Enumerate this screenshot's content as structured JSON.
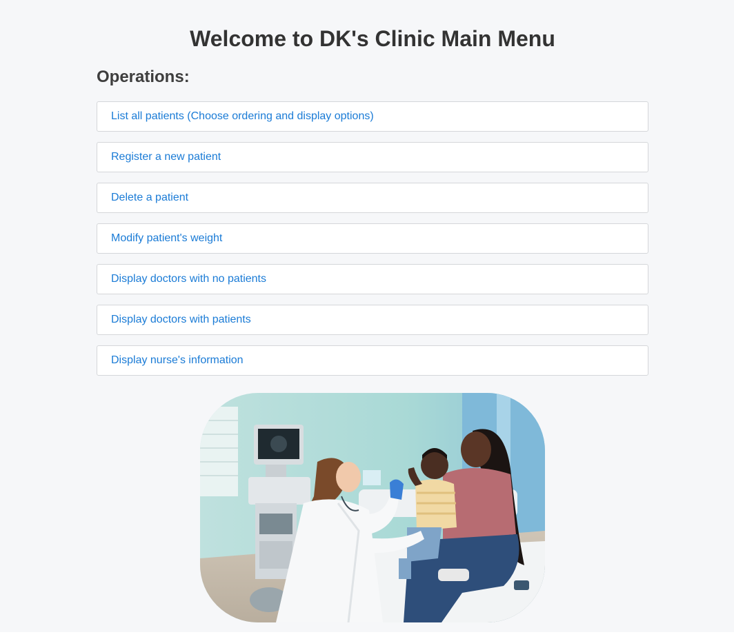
{
  "page": {
    "title": "Welcome to DK's Clinic Main Menu",
    "section_heading": "Operations:"
  },
  "menu": {
    "items": [
      {
        "label": "List all patients (Choose ordering and display options)"
      },
      {
        "label": "Register a new patient"
      },
      {
        "label": "Delete a patient"
      },
      {
        "label": "Modify patient's weight"
      },
      {
        "label": "Display doctors with no patients"
      },
      {
        "label": "Display doctors with patients"
      },
      {
        "label": "Display nurse's information"
      }
    ]
  },
  "colors": {
    "background": "#f6f7f9",
    "link": "#1a7bd6",
    "heading": "#333333",
    "button_border": "#d4d6d9"
  },
  "image": {
    "subject": "clinic-photo"
  }
}
